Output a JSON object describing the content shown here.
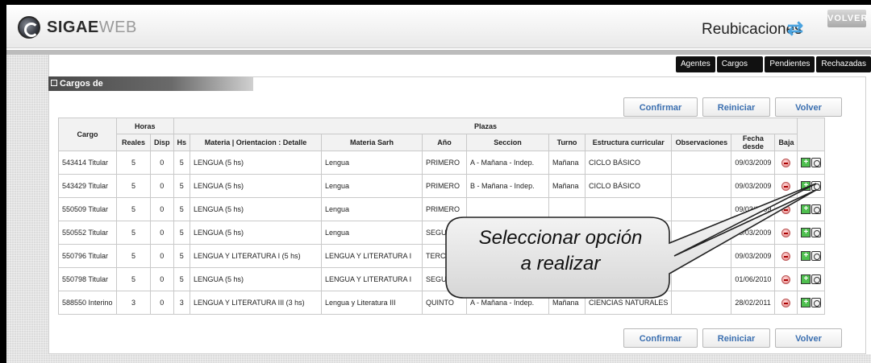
{
  "header": {
    "logo_a": "SIGAE",
    "logo_b": "WEB",
    "title": "Reubicaciones",
    "back": "VOLVER"
  },
  "tabs": [
    "Agentes",
    "Cargos vacantes",
    "Pendientes",
    "Rechazadas"
  ],
  "panel": {
    "title": "Cargos de"
  },
  "buttons": {
    "confirm": "Confirmar",
    "reset": "Reiniciar",
    "back": "Volver"
  },
  "table": {
    "headers": {
      "cargo": "Cargo",
      "horas": "Horas",
      "plazas": "Plazas",
      "reales": "Reales",
      "disp": "Disp",
      "hs": "Hs",
      "materia": "Materia | Orientacion : Detalle",
      "materia_sarh": "Materia Sarh",
      "anio": "Año",
      "seccion": "Seccion",
      "turno": "Turno",
      "estructura": "Estructura curricular",
      "observaciones": "Observaciones",
      "fecha": "Fecha desde",
      "baja": "Baja"
    },
    "rows": [
      {
        "cargo": "543414 Titular",
        "reales": "5",
        "disp": "0",
        "hs": "5",
        "materia": "LENGUA (5 hs)",
        "sarh": "Lengua",
        "anio": "PRIMERO",
        "seccion": "A - Mañana - Indep.",
        "turno": "Mañana",
        "estructura": "CICLO BÁSICO",
        "obs": "",
        "fecha": "09/03/2009"
      },
      {
        "cargo": "543429 Titular",
        "reales": "5",
        "disp": "0",
        "hs": "5",
        "materia": "LENGUA (5 hs)",
        "sarh": "Lengua",
        "anio": "PRIMERO",
        "seccion": "B - Mañana - Indep.",
        "turno": "Mañana",
        "estructura": "CICLO BÁSICO",
        "obs": "",
        "fecha": "09/03/2009"
      },
      {
        "cargo": "550509 Titular",
        "reales": "5",
        "disp": "0",
        "hs": "5",
        "materia": "LENGUA (5 hs)",
        "sarh": "Lengua",
        "anio": "PRIMERO",
        "seccion": "",
        "turno": "",
        "estructura": "",
        "obs": "",
        "fecha": "09/03/2009"
      },
      {
        "cargo": "550552 Titular",
        "reales": "5",
        "disp": "0",
        "hs": "5",
        "materia": "LENGUA (5 hs)",
        "sarh": "Lengua",
        "anio": "SEGUNDO",
        "seccion": "",
        "turno": "",
        "estructura": "",
        "obs": "",
        "fecha": "09/03/2009"
      },
      {
        "cargo": "550796 Titular",
        "reales": "5",
        "disp": "0",
        "hs": "5",
        "materia": "LENGUA Y LITERATURA I (5 hs)",
        "sarh": "LENGUA Y LITERATURA I",
        "anio": "TERCERO",
        "seccion": "",
        "turno": "",
        "estructura": "",
        "obs": "",
        "fecha": "09/03/2009"
      },
      {
        "cargo": "550798 Titular",
        "reales": "5",
        "disp": "0",
        "hs": "5",
        "materia": "LENGUA (5 hs)",
        "sarh": "LENGUA Y LITERATURA I",
        "anio": "SEGUNDO",
        "seccion": "",
        "turno": "",
        "estructura": "",
        "obs": "",
        "fecha": "01/06/2010"
      },
      {
        "cargo": "588550 Interino",
        "reales": "3",
        "disp": "0",
        "hs": "3",
        "materia": "LENGUA Y LITERATURA III (3 hs)",
        "sarh": "Lengua y Literatura III",
        "anio": "QUINTO",
        "seccion": "A - Mañana - Indep.",
        "turno": "Mañana",
        "estructura": "CIENCIAS NATURALES",
        "obs": "",
        "fecha": "28/02/2011"
      }
    ]
  },
  "callout": {
    "line1": "Seleccionar opción",
    "line2": "a realizar"
  }
}
